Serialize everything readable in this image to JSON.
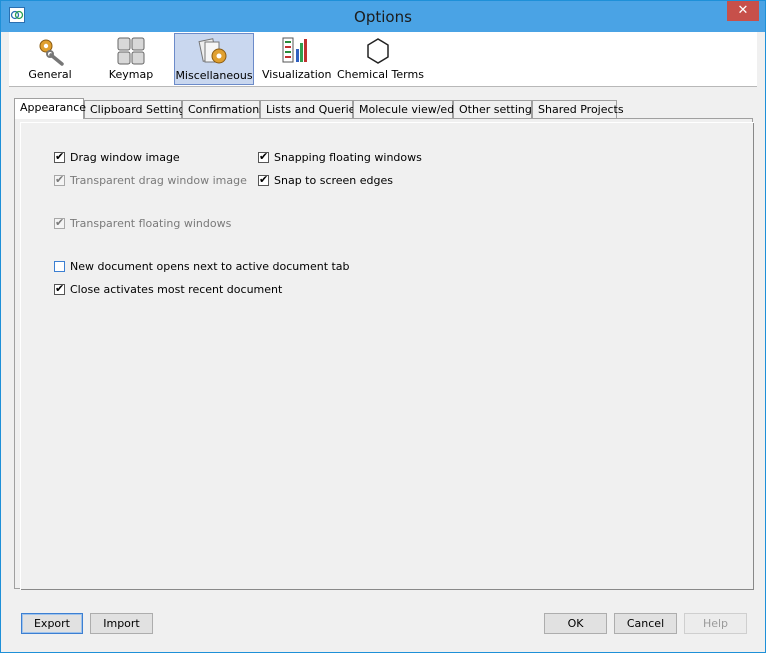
{
  "window": {
    "title": "Options"
  },
  "titlebar": {
    "close_glyph": "✕",
    "app_icon": "app-logo-icon"
  },
  "toolbar": {
    "items": [
      {
        "label": "General",
        "icon": "wrench-gear-icon"
      },
      {
        "label": "Keymap",
        "icon": "keyboard-icon"
      },
      {
        "label": "Miscellaneous",
        "icon": "misc-gear-icon"
      },
      {
        "label": "Visualization",
        "icon": "chart-icon"
      },
      {
        "label": "Chemical Terms",
        "icon": "benzene-icon"
      }
    ],
    "selected": "Miscellaneous"
  },
  "tabs": [
    "Appearance",
    "Clipboard Settings",
    "Confirmations",
    "Lists and Queries",
    "Molecule view/edit",
    "Other settings",
    "Shared Projects"
  ],
  "active_tab": "Appearance",
  "options": {
    "drag_window_image": {
      "label": "Drag window image",
      "checked": true,
      "enabled": true
    },
    "transparent_drag_window_image": {
      "label": "Transparent drag window image",
      "checked": true,
      "enabled": false
    },
    "transparent_floating_windows": {
      "label": "Transparent floating windows",
      "checked": true,
      "enabled": false
    },
    "new_document_next_to_active": {
      "label": "New document opens next to active document tab",
      "checked": false,
      "enabled": true
    },
    "close_activates_recent": {
      "label": "Close activates most recent document",
      "checked": true,
      "enabled": true
    },
    "snapping_floating_windows": {
      "label": "Snapping floating windows",
      "checked": true,
      "enabled": true
    },
    "snap_to_screen_edges": {
      "label": "Snap to screen edges",
      "checked": true,
      "enabled": true
    }
  },
  "buttons": {
    "export": "Export",
    "import": "Import",
    "ok": "OK",
    "cancel": "Cancel",
    "help": "Help"
  },
  "colors": {
    "titlebar": "#4aa3e5",
    "selected_toolbar": "#c9d7ef",
    "close_button": "#c7504a"
  }
}
